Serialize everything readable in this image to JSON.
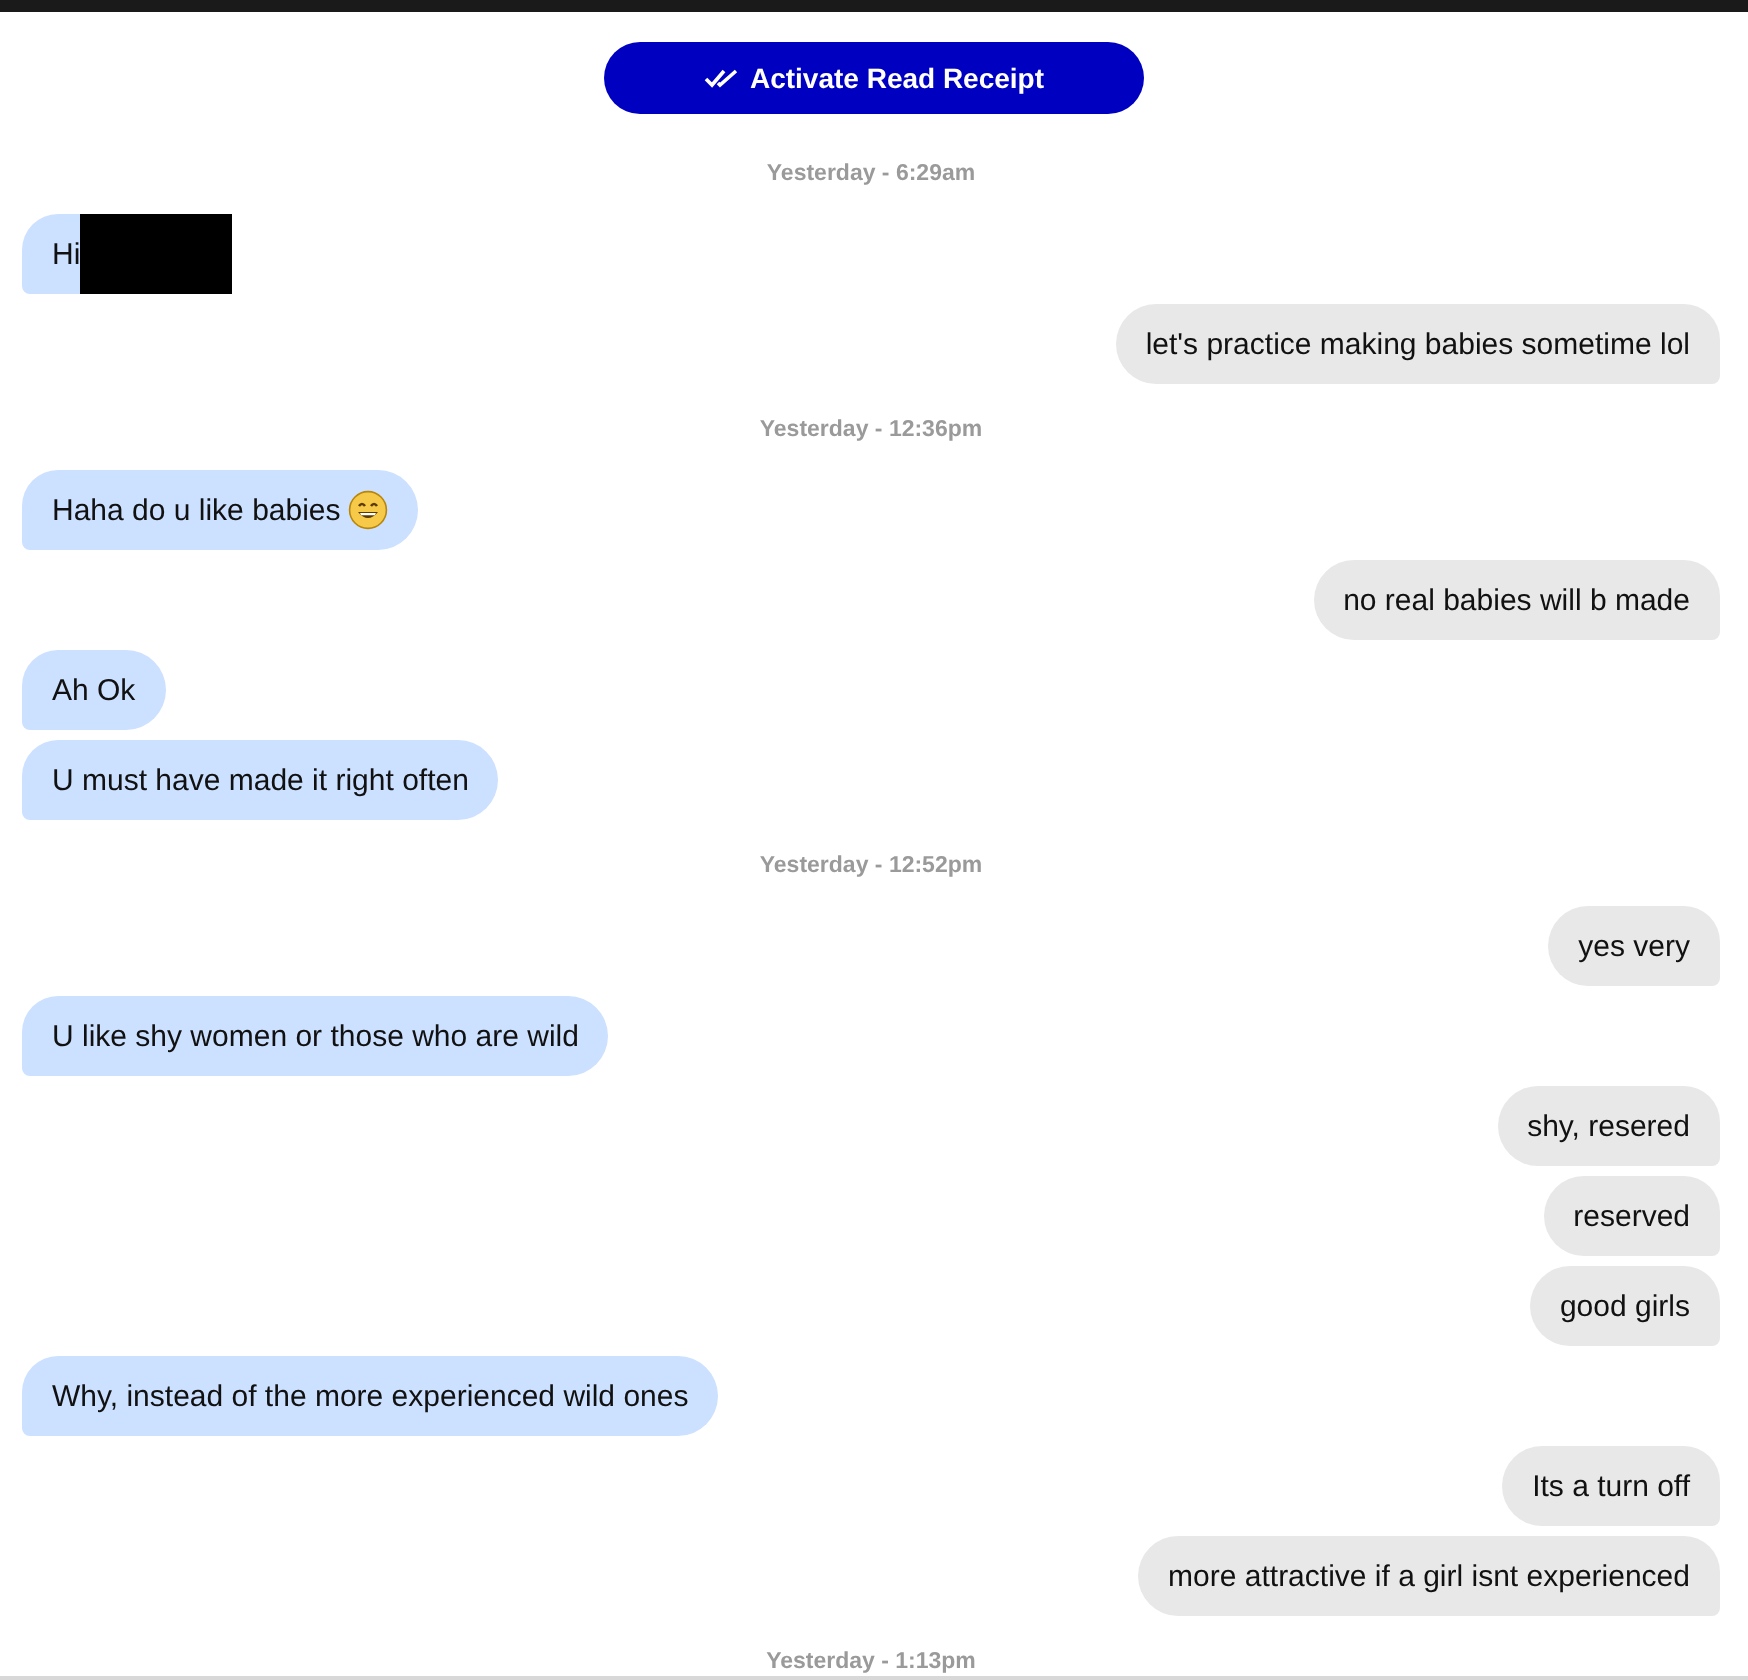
{
  "read_receipt_button": {
    "label": "Activate Read Receipt"
  },
  "items": [
    {
      "kind": "timestamp",
      "text": "Yesterday - 6:29am"
    },
    {
      "kind": "incoming",
      "text": "Hi",
      "redacted": true
    },
    {
      "kind": "outgoing",
      "text": "let's practice making babies sometime lol"
    },
    {
      "kind": "timestamp",
      "text": "Yesterday - 12:36pm"
    },
    {
      "kind": "incoming",
      "text": "Haha do u like babies",
      "emoji": true
    },
    {
      "kind": "outgoing",
      "text": "no real babies will b made"
    },
    {
      "kind": "incoming",
      "text": "Ah Ok"
    },
    {
      "kind": "incoming",
      "text": "U must have made it right often"
    },
    {
      "kind": "timestamp",
      "text": "Yesterday - 12:52pm"
    },
    {
      "kind": "outgoing",
      "text": "yes very"
    },
    {
      "kind": "incoming",
      "text": "U like shy women or those who are wild"
    },
    {
      "kind": "outgoing",
      "text": "shy, resered"
    },
    {
      "kind": "outgoing",
      "text": "reserved"
    },
    {
      "kind": "outgoing",
      "text": "good girls"
    },
    {
      "kind": "incoming",
      "text": "Why, instead of the more experienced wild ones"
    },
    {
      "kind": "outgoing",
      "text": "Its a turn off"
    },
    {
      "kind": "outgoing",
      "text": "more attractive if a girl isnt experienced"
    },
    {
      "kind": "timestamp",
      "text": "Yesterday - 1:13pm"
    }
  ]
}
